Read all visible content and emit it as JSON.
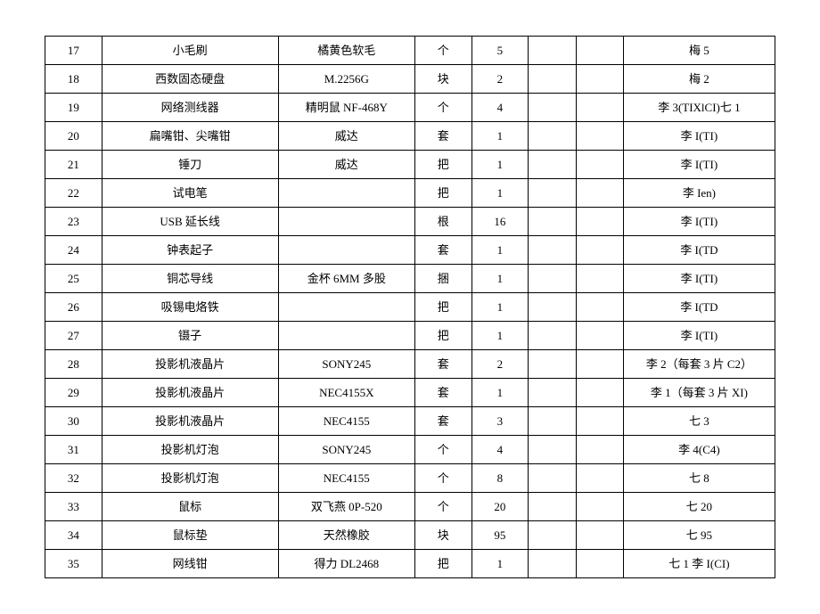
{
  "chart_data": {
    "type": "table",
    "rows": [
      {
        "idx": "17",
        "name": "小毛刷",
        "spec": "橘黄色软毛",
        "unit": "个",
        "qty": "5",
        "c6": "",
        "c7": "",
        "note": "梅 5"
      },
      {
        "idx": "18",
        "name": "西数固态硬盘",
        "spec": "M.2256G",
        "unit": "块",
        "qty": "2",
        "c6": "",
        "c7": "",
        "note": "梅 2"
      },
      {
        "idx": "19",
        "name": "网络测线器",
        "spec": "精明鼠 NF-468Y",
        "unit": "个",
        "qty": "4",
        "c6": "",
        "c7": "",
        "note": "李 3(TIXlCI)七 1"
      },
      {
        "idx": "20",
        "name": "扁嘴钳、尖嘴钳",
        "spec": "威达",
        "unit": "套",
        "qty": "1",
        "c6": "",
        "c7": "",
        "note": "李 I(TI)"
      },
      {
        "idx": "21",
        "name": "锤刀",
        "spec": "威达",
        "unit": "把",
        "qty": "1",
        "c6": "",
        "c7": "",
        "note": "李 I(TI)"
      },
      {
        "idx": "22",
        "name": "试电笔",
        "spec": "",
        "unit": "把",
        "qty": "1",
        "c6": "",
        "c7": "",
        "note": "李 Ien)"
      },
      {
        "idx": "23",
        "name": "USB 延长线",
        "spec": "",
        "unit": "根",
        "qty": "16",
        "c6": "",
        "c7": "",
        "note": "李 I(TI)"
      },
      {
        "idx": "24",
        "name": "钟表起子",
        "spec": "",
        "unit": "套",
        "qty": "1",
        "c6": "",
        "c7": "",
        "note": "李 I(TD"
      },
      {
        "idx": "25",
        "name": "铜芯导线",
        "spec": "金杯 6MM 多股",
        "unit": "捆",
        "qty": "1",
        "c6": "",
        "c7": "",
        "note": "李 I(TI)"
      },
      {
        "idx": "26",
        "name": "吸锡电烙铁",
        "spec": "",
        "unit": "把",
        "qty": "1",
        "c6": "",
        "c7": "",
        "note": "李 I(TD"
      },
      {
        "idx": "27",
        "name": "镊子",
        "spec": "",
        "unit": "把",
        "qty": "1",
        "c6": "",
        "c7": "",
        "note": "李 I(TI)"
      },
      {
        "idx": "28",
        "name": "投影机液晶片",
        "spec": "SONY245",
        "unit": "套",
        "qty": "2",
        "c6": "",
        "c7": "",
        "note": "李 2（每套 3 片 C2）"
      },
      {
        "idx": "29",
        "name": "投影机液晶片",
        "spec": "NEC4155X",
        "unit": "套",
        "qty": "1",
        "c6": "",
        "c7": "",
        "note": "李 1（每套 3 片 XI)"
      },
      {
        "idx": "30",
        "name": "投影机液晶片",
        "spec": "NEC4155",
        "unit": "套",
        "qty": "3",
        "c6": "",
        "c7": "",
        "note": "七 3"
      },
      {
        "idx": "31",
        "name": "投影机灯泡",
        "spec": "SONY245",
        "unit": "个",
        "qty": "4",
        "c6": "",
        "c7": "",
        "note": "李 4(C4)"
      },
      {
        "idx": "32",
        "name": "投影机灯泡",
        "spec": "NEC4155",
        "unit": "个",
        "qty": "8",
        "c6": "",
        "c7": "",
        "note": "七 8"
      },
      {
        "idx": "33",
        "name": "鼠标",
        "spec": "双飞燕 0P-520",
        "unit": "个",
        "qty": "20",
        "c6": "",
        "c7": "",
        "note": "七 20"
      },
      {
        "idx": "34",
        "name": "鼠标垫",
        "spec": "天然橡胶",
        "unit": "块",
        "qty": "95",
        "c6": "",
        "c7": "",
        "note": "七 95"
      },
      {
        "idx": "35",
        "name": "网线钳",
        "spec": "得力 DL2468",
        "unit": "把",
        "qty": "1",
        "c6": "",
        "c7": "",
        "note": "七 1 李 I(CI)"
      }
    ]
  }
}
